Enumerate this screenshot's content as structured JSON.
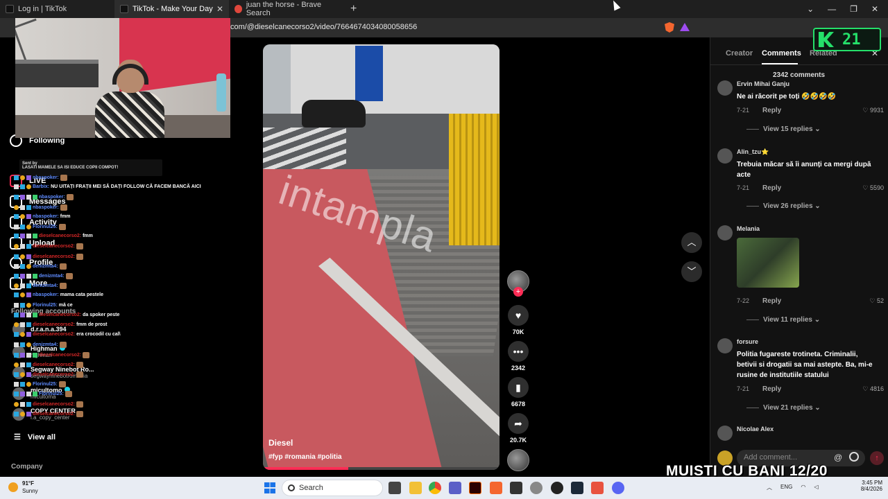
{
  "browser": {
    "tabs": [
      {
        "title": "Log in | TikTok",
        "active": false
      },
      {
        "title": "TikTok - Make Your Day",
        "active": true
      },
      {
        "title": "juan the horse - Brave Search",
        "active": false
      }
    ],
    "url": "com/@dieselcanecorso2/video/7664674034080058656"
  },
  "sidebar": {
    "nav": [
      {
        "label": "Following"
      },
      {
        "label": "LIVE"
      },
      {
        "label": "Messages"
      },
      {
        "label": "Activity"
      },
      {
        "label": "Upload"
      },
      {
        "label": "Profile"
      },
      {
        "label": "More"
      }
    ],
    "following_heading": "Following accounts",
    "accounts": [
      {
        "name": "d.r.a.n.a.394",
        "sub": ""
      },
      {
        "name": "Highman",
        "sub": "highman"
      },
      {
        "name": "Segway Ninebot Ro...",
        "sub": "segwayninebotromania"
      },
      {
        "name": "micultomo",
        "sub": "micultoma"
      },
      {
        "name": "COPY CENTER",
        "sub": "l.a_copy_center"
      }
    ],
    "view_all": "View all",
    "company": "Company"
  },
  "chat": {
    "pinned_header": "Sent by",
    "pinned_text": "LASATI MAMELE SA ISI EDUCE COPII COMPOT!",
    "lines": [
      {
        "user": "nbaspoker:",
        "msg": "",
        "color": "blue"
      },
      {
        "user": "Barbix:",
        "msg": "NU UITAȚI FRAȚII MEI SĂ DAȚI FOLLOW CĂ FACEM BANCĂ AICI",
        "color": "blue"
      },
      {
        "user": "nbaspoker:",
        "msg": "",
        "color": "blue"
      },
      {
        "user": "nbaspoker:",
        "msg": "",
        "color": "blue"
      },
      {
        "user": "nbaspoker:",
        "msg": "fmm",
        "color": "blue"
      },
      {
        "user": "Florinul25:",
        "msg": "",
        "color": "blue"
      },
      {
        "user": "dieselcanecorso2:",
        "msg": "fmm",
        "color": "red"
      },
      {
        "user": "dieselcanecorso2:",
        "msg": "",
        "color": "red"
      },
      {
        "user": "dieselcanecorso2:",
        "msg": "",
        "color": "red"
      },
      {
        "user": "denizmta4:",
        "msg": "",
        "color": "blue"
      },
      {
        "user": "denizmta4:",
        "msg": "",
        "color": "blue"
      },
      {
        "user": "denizmta4:",
        "msg": "",
        "color": "blue"
      },
      {
        "user": "nbaspoker:",
        "msg": "mama cata pestele",
        "color": "blue"
      },
      {
        "user": "Florinul25:",
        "msg": "mă ce",
        "color": "blue"
      },
      {
        "user": "dieselcanecorso2:",
        "msg": "da spoker peste",
        "color": "red"
      },
      {
        "user": "dieselcanecorso2:",
        "msg": "fmm de prost",
        "color": "red"
      },
      {
        "user": "dieselcanecorso2:",
        "msg": "era crocodil cu cal\\",
        "color": "red"
      },
      {
        "user": "denizmta4:",
        "msg": "",
        "color": "blue"
      },
      {
        "user": "dieselcanecorso2:",
        "msg": "",
        "color": "red"
      },
      {
        "user": "dieselcanecorso2:",
        "msg": "",
        "color": "red"
      },
      {
        "user": "dieselcanecorso2:",
        "msg": "",
        "color": "red"
      },
      {
        "user": "Florinul25:",
        "msg": "",
        "color": "blue"
      },
      {
        "user": "Florinul25:",
        "msg": "",
        "color": "blue"
      },
      {
        "user": "dieselcanecorso2:",
        "msg": "",
        "color": "red"
      },
      {
        "user": "dieselcanecorso2:",
        "msg": "",
        "color": "red"
      }
    ]
  },
  "video": {
    "watermark": "intampla",
    "author": "Diesel",
    "tags": "#fyp #romania #politia",
    "progress_fraction": 0.36
  },
  "actions": {
    "likes": "70K",
    "comments": "2342",
    "saves": "6678",
    "shares": "20.7K"
  },
  "panel": {
    "tabs": [
      {
        "label": "Creator"
      },
      {
        "label": "Comments"
      },
      {
        "label": "Related"
      }
    ],
    "count_label": "2342 comments",
    "comments": [
      {
        "user": "Ervin Mihai Ganju",
        "text": "Ne ai răcorit pe toți 🤣🤣🤣🤣",
        "date": "7-21",
        "likes": "9931",
        "replies": "View 15 replies"
      },
      {
        "user": "Alin_tzu⭐",
        "text": "Trebuia măcar să îi anunți ca mergi după acte",
        "date": "7-21",
        "likes": "5590",
        "replies": "View 26 replies"
      },
      {
        "user": "Melania",
        "text": "",
        "date": "7-22",
        "likes": "52",
        "replies": "View 11 replies"
      },
      {
        "user": "forsure",
        "text": "Politia fugareste trotineta. Criminalii, betivii si drogatii sa mai astepte. Ba, mi-e rusine de institutiile statului",
        "date": "7-21",
        "likes": "4816",
        "replies": "View 21 replies"
      },
      {
        "user": "Nicolae Alex",
        "text": "",
        "date": "",
        "likes": "",
        "replies": ""
      }
    ],
    "reply_label": "Reply",
    "add_comment_placeholder": "Add comment...",
    "at_symbol": "@"
  },
  "overlay": {
    "counter": "21",
    "banner": "MUISTI CU BANI 12/20"
  },
  "taskbar": {
    "temp": "91°F",
    "weather": "Sunny",
    "search": "Search",
    "lang": "ENG",
    "time": "3:45 PM",
    "date": "8/4/2026"
  },
  "colors": {
    "accent": "#fe2c55",
    "counter_green": "#25e06a",
    "link_blue": "#20d5ec"
  }
}
